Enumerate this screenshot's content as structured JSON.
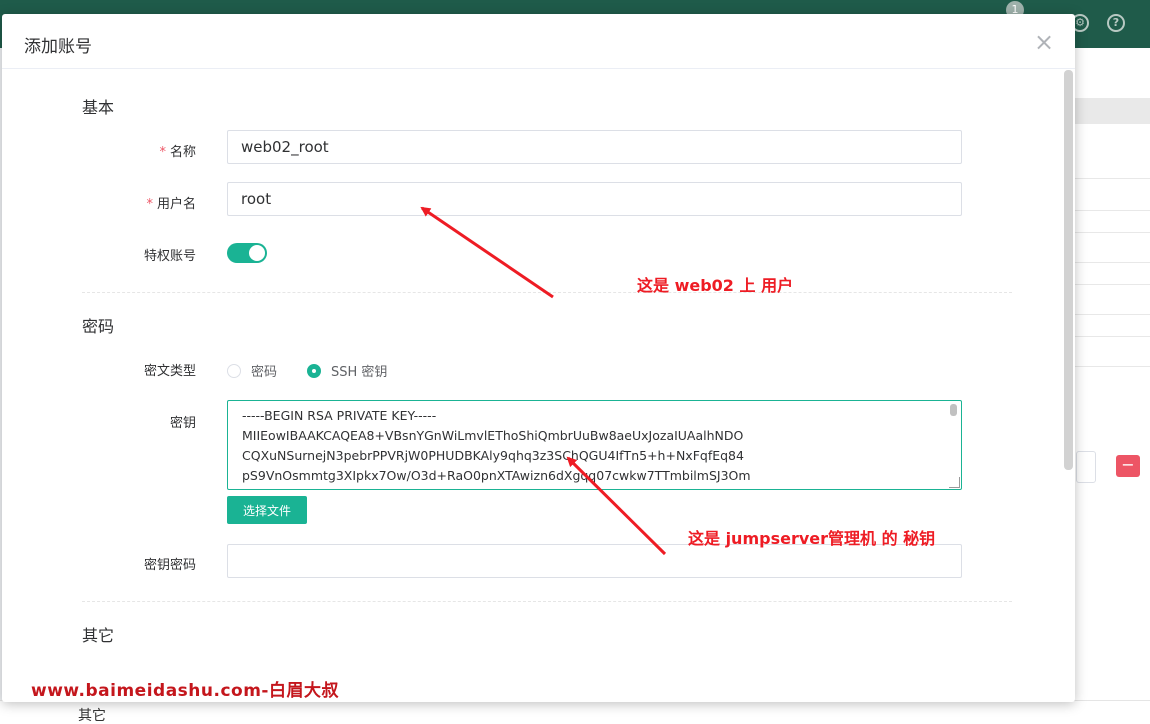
{
  "background": {
    "notification_count": "1",
    "bottom_label": "其它"
  },
  "dialog": {
    "title": "添加账号",
    "close_label": "×",
    "sections": {
      "basic": "基本",
      "password": "密码",
      "other": "其它"
    },
    "fields": {
      "name": {
        "label": "名称",
        "required_mark": "*",
        "value": "web02_root"
      },
      "username": {
        "label": "用户名",
        "required_mark": "*",
        "value": "root"
      },
      "privileged": {
        "label": "特权账号",
        "enabled": true
      },
      "secret_type": {
        "label": "密文类型",
        "options": [
          {
            "label": "密码",
            "checked": false
          },
          {
            "label": "SSH 密钥",
            "checked": true
          }
        ]
      },
      "secret_key": {
        "label": "密钥",
        "value": "-----BEGIN RSA PRIVATE KEY-----\nMIIEowIBAAKCAQEA8+VBsnYGnWiLmvlEThoShiQmbrUuBw8aeUxJozaIUAalhNDO\nCQXuNSurnejN3pebrPPVRjW0PHUDBKAly9qhq3z3SChQGU4IfTn5+h+NxFqfEq84\npS9VnOsmmtg3XIpkx7Ow/O3d+RaO0pnXTAwizn6dXgqq07cwkw7TTmbilmSJ3Om"
      },
      "choose_file_label": "选择文件",
      "key_password": {
        "label": "密钥密码",
        "value": ""
      }
    }
  },
  "annotations": {
    "user_note": "这是 web02 上 用户",
    "key_note": "这是 jumpserver管理机 的  秘钥",
    "watermark": "www.baimeidashu.com-白眉大叔"
  },
  "colors": {
    "accent": "#1ab394",
    "topbar": "#1f5b4a",
    "annotation": "#ee1c24",
    "danger": "#ed5565"
  }
}
